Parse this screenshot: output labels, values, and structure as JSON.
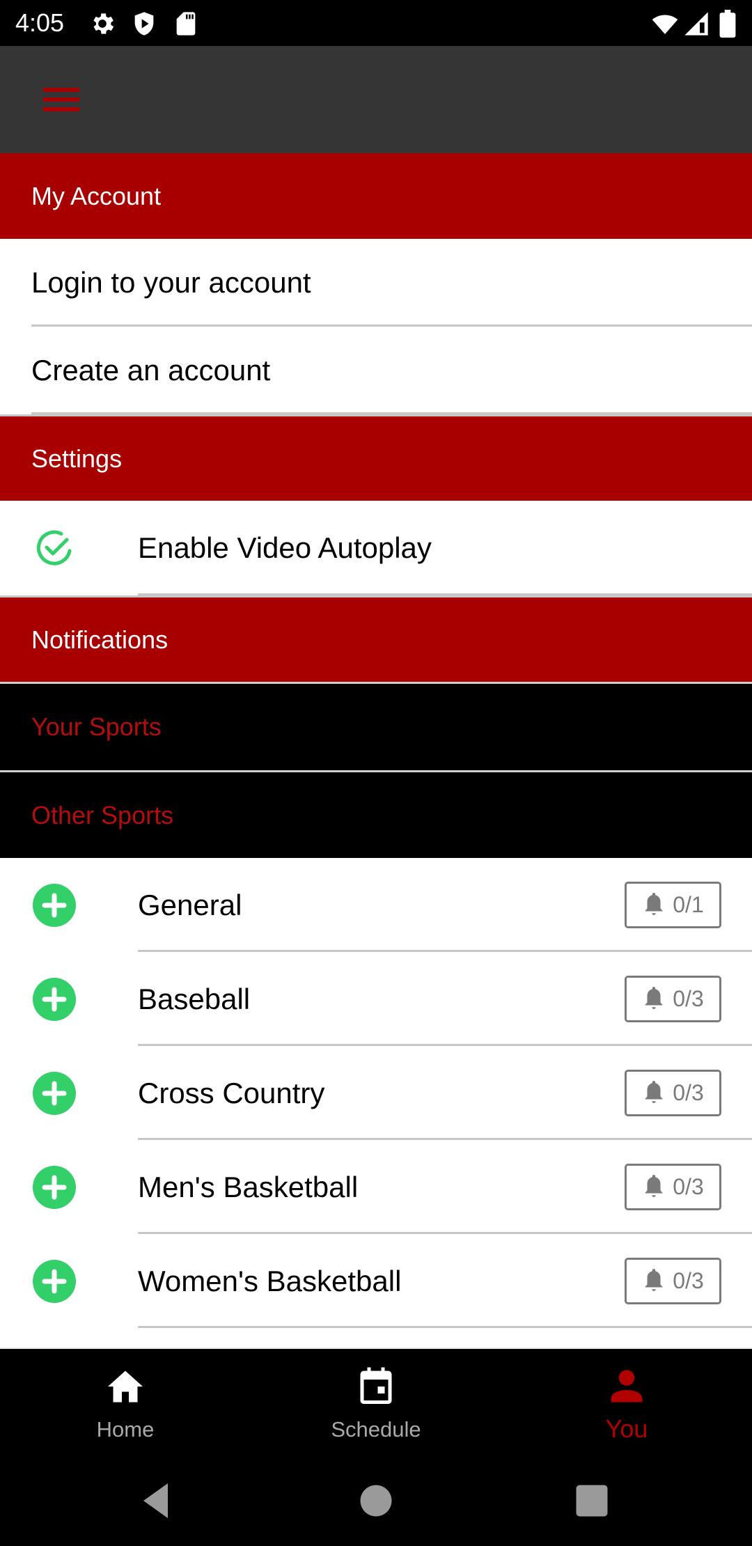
{
  "status_bar": {
    "time": "4:05",
    "left_icons": [
      "gear-icon",
      "shield-play-icon",
      "sd-card-icon"
    ],
    "right_icons": [
      "wifi-icon",
      "cell-signal-icon",
      "battery-icon"
    ]
  },
  "app_bar": {
    "menu_icon": "hamburger-menu-icon"
  },
  "sections": {
    "my_account": {
      "title": "My Account",
      "items": [
        {
          "label": "Login to your account"
        },
        {
          "label": "Create an account"
        }
      ]
    },
    "settings": {
      "title": "Settings",
      "items": [
        {
          "label": "Enable Video Autoplay",
          "icon": "check-circle-icon",
          "checked": true
        }
      ]
    },
    "notifications": {
      "title": "Notifications",
      "your_sports_label": "Your Sports",
      "other_sports_label": "Other Sports",
      "other_sports": [
        {
          "name": "General",
          "subscribed": 0,
          "total": 1,
          "count_text": "0/1"
        },
        {
          "name": "Baseball",
          "subscribed": 0,
          "total": 3,
          "count_text": "0/3"
        },
        {
          "name": "Cross Country",
          "subscribed": 0,
          "total": 3,
          "count_text": "0/3"
        },
        {
          "name": "Men's Basketball",
          "subscribed": 0,
          "total": 3,
          "count_text": "0/3"
        },
        {
          "name": "Women's Basketball",
          "subscribed": 0,
          "total": 3,
          "count_text": "0/3"
        }
      ]
    }
  },
  "bottom_nav": {
    "tabs": [
      {
        "label": "Home",
        "icon": "home-icon",
        "active": false
      },
      {
        "label": "Schedule",
        "icon": "calendar-icon",
        "active": false
      },
      {
        "label": "You",
        "icon": "person-icon",
        "active": true
      }
    ]
  },
  "system_nav": {
    "buttons": [
      "back-icon",
      "home-circle-icon",
      "recents-square-icon"
    ]
  },
  "colors": {
    "accent_red": "#a80000",
    "app_bar_bg": "#353535",
    "success_green": "#33d06a",
    "badge_gray": "#7a7a7a",
    "inactive_nav": "#aaaaaa"
  }
}
